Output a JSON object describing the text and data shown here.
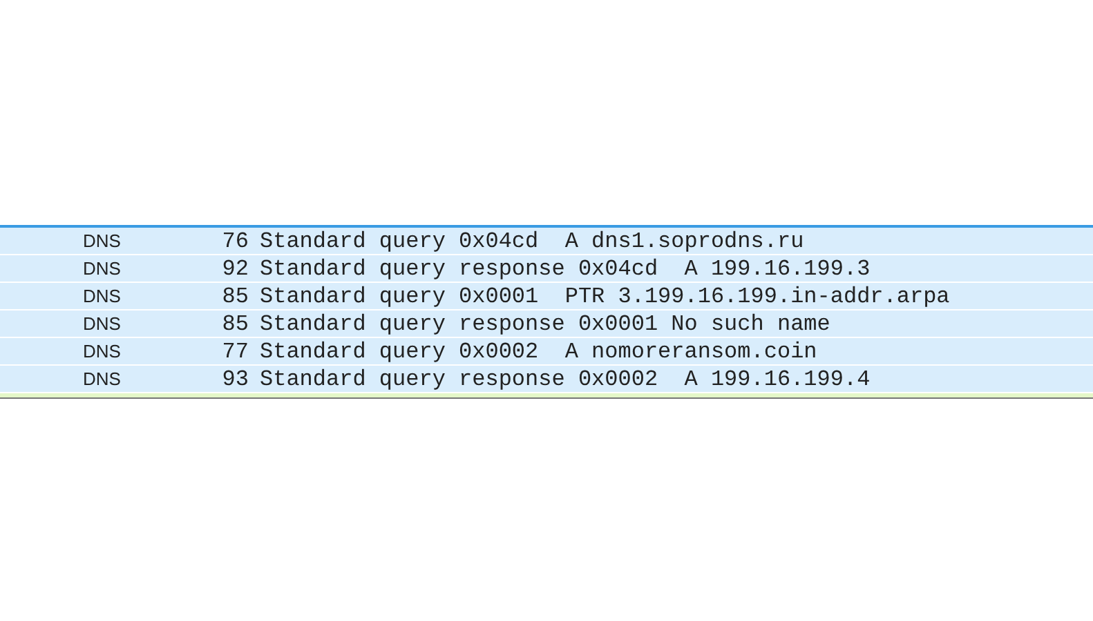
{
  "packet_list": {
    "rows": [
      {
        "protocol": "DNS",
        "length": "76",
        "info": "Standard query 0x04cd  A dns1.soprodns.ru"
      },
      {
        "protocol": "DNS",
        "length": "92",
        "info": "Standard query response 0x04cd  A 199.16.199.3"
      },
      {
        "protocol": "DNS",
        "length": "85",
        "info": "Standard query 0x0001  PTR 3.199.16.199.in-addr.arpa"
      },
      {
        "protocol": "DNS",
        "length": "85",
        "info": "Standard query response 0x0001 No such name"
      },
      {
        "protocol": "DNS",
        "length": "77",
        "info": "Standard query 0x0002  A nomoreransom.coin"
      },
      {
        "protocol": "DNS",
        "length": "93",
        "info": "Standard query response 0x0002  A 199.16.199.4"
      }
    ]
  }
}
